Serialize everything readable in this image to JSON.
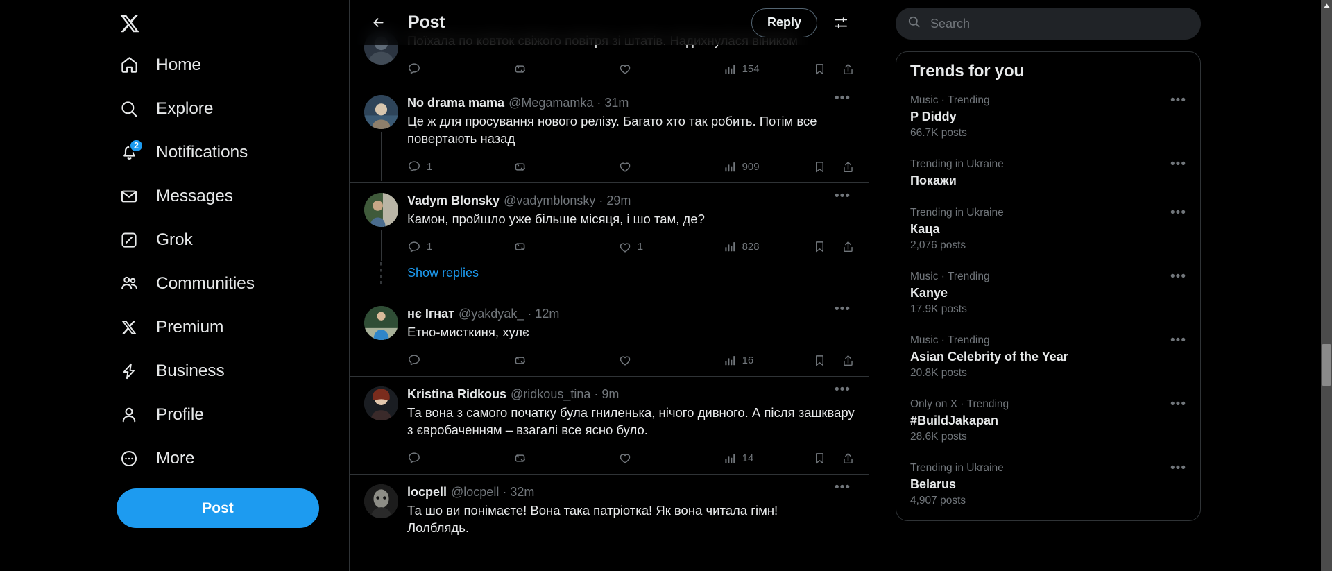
{
  "colors": {
    "accent": "#1d9bf0",
    "bg": "#000000",
    "border": "#2f3336",
    "muted": "#71767b",
    "text": "#e7e9ea"
  },
  "sidebar": {
    "logo": "x-logo",
    "items": [
      {
        "label": "Home",
        "icon": "home-icon",
        "badge": ""
      },
      {
        "label": "Explore",
        "icon": "search-icon",
        "badge": ""
      },
      {
        "label": "Notifications",
        "icon": "bell-icon",
        "badge": "2"
      },
      {
        "label": "Messages",
        "icon": "envelope-icon",
        "badge": ""
      },
      {
        "label": "Grok",
        "icon": "grok-icon",
        "badge": ""
      },
      {
        "label": "Communities",
        "icon": "people-icon",
        "badge": ""
      },
      {
        "label": "Premium",
        "icon": "x-icon",
        "badge": ""
      },
      {
        "label": "Business",
        "icon": "lightning-icon",
        "badge": ""
      },
      {
        "label": "Profile",
        "icon": "person-icon",
        "badge": ""
      },
      {
        "label": "More",
        "icon": "more-circle-icon",
        "badge": ""
      }
    ],
    "post_button": "Post"
  },
  "header": {
    "back": "back-arrow-icon",
    "title": "Post",
    "reply_button": "Reply",
    "settings": "display-settings-icon"
  },
  "feed": {
    "tweets": [
      {
        "name": "",
        "handle": "",
        "time": "",
        "text": "Поїхала по ковток свіжого повітря зі штатів. Надихнулася віником",
        "replies": "",
        "reposts": "",
        "likes": "",
        "views": "154",
        "partial": true,
        "thread": false
      },
      {
        "name": "No drama mama",
        "handle": "@Megamamka",
        "time": "31m",
        "text": "Це ж для просування нового релізу. Багато хто так робить. Потім все повертають назад",
        "replies": "1",
        "reposts": "",
        "likes": "",
        "views": "909",
        "partial": false,
        "thread": true
      },
      {
        "name": "Vadym Blonsky",
        "handle": "@vadymblonsky",
        "time": "29m",
        "text": "Камон, пройшло уже більше місяця, і шо там, де?",
        "replies": "1",
        "reposts": "",
        "likes": "1",
        "views": "828",
        "partial": false,
        "thread": true
      },
      {
        "name": "нє Ігнат",
        "handle": "@yakdyak_",
        "time": "12m",
        "text": "Етно-мисткиня, хулє",
        "replies": "",
        "reposts": "",
        "likes": "",
        "views": "16",
        "partial": false,
        "thread": false
      },
      {
        "name": "Kristina Ridkous",
        "handle": "@ridkous_tina",
        "time": "9m",
        "text": "Та вона з самого початку була гниленька, нічого дивного. А після зашквару з євробаченням – взагалі все ясно було.",
        "replies": "",
        "reposts": "",
        "likes": "",
        "views": "14",
        "partial": false,
        "thread": false
      },
      {
        "name": "locpell",
        "handle": "@locpell",
        "time": "32m",
        "text": "Та шо ви понімаєте! Вона така патріотка! Як вона читала гімн!\nЛолблядь.",
        "replies": "",
        "reposts": "",
        "likes": "",
        "views": "",
        "partial": false,
        "thread": false
      }
    ],
    "show_replies": "Show replies"
  },
  "search": {
    "placeholder": "Search",
    "value": "",
    "icon": "search-icon"
  },
  "trends": {
    "title": "Trends for you",
    "items": [
      {
        "category": "Music · Trending",
        "name": "P Diddy",
        "count": "66.7K posts"
      },
      {
        "category": "Trending in Ukraine",
        "name": "Покажи",
        "count": ""
      },
      {
        "category": "Trending in Ukraine",
        "name": "Каца",
        "count": "2,076 posts"
      },
      {
        "category": "Music · Trending",
        "name": "Kanye",
        "count": "17.9K posts"
      },
      {
        "category": "Music · Trending",
        "name": "Asian Celebrity of the Year",
        "count": "20.8K posts"
      },
      {
        "category": "Only on X · Trending",
        "name": "#BuildJakapan",
        "count": "28.6K posts"
      },
      {
        "category": "Trending in Ukraine",
        "name": "Belarus",
        "count": "4,907 posts"
      }
    ],
    "more_icon": "more-horizontal-icon"
  }
}
